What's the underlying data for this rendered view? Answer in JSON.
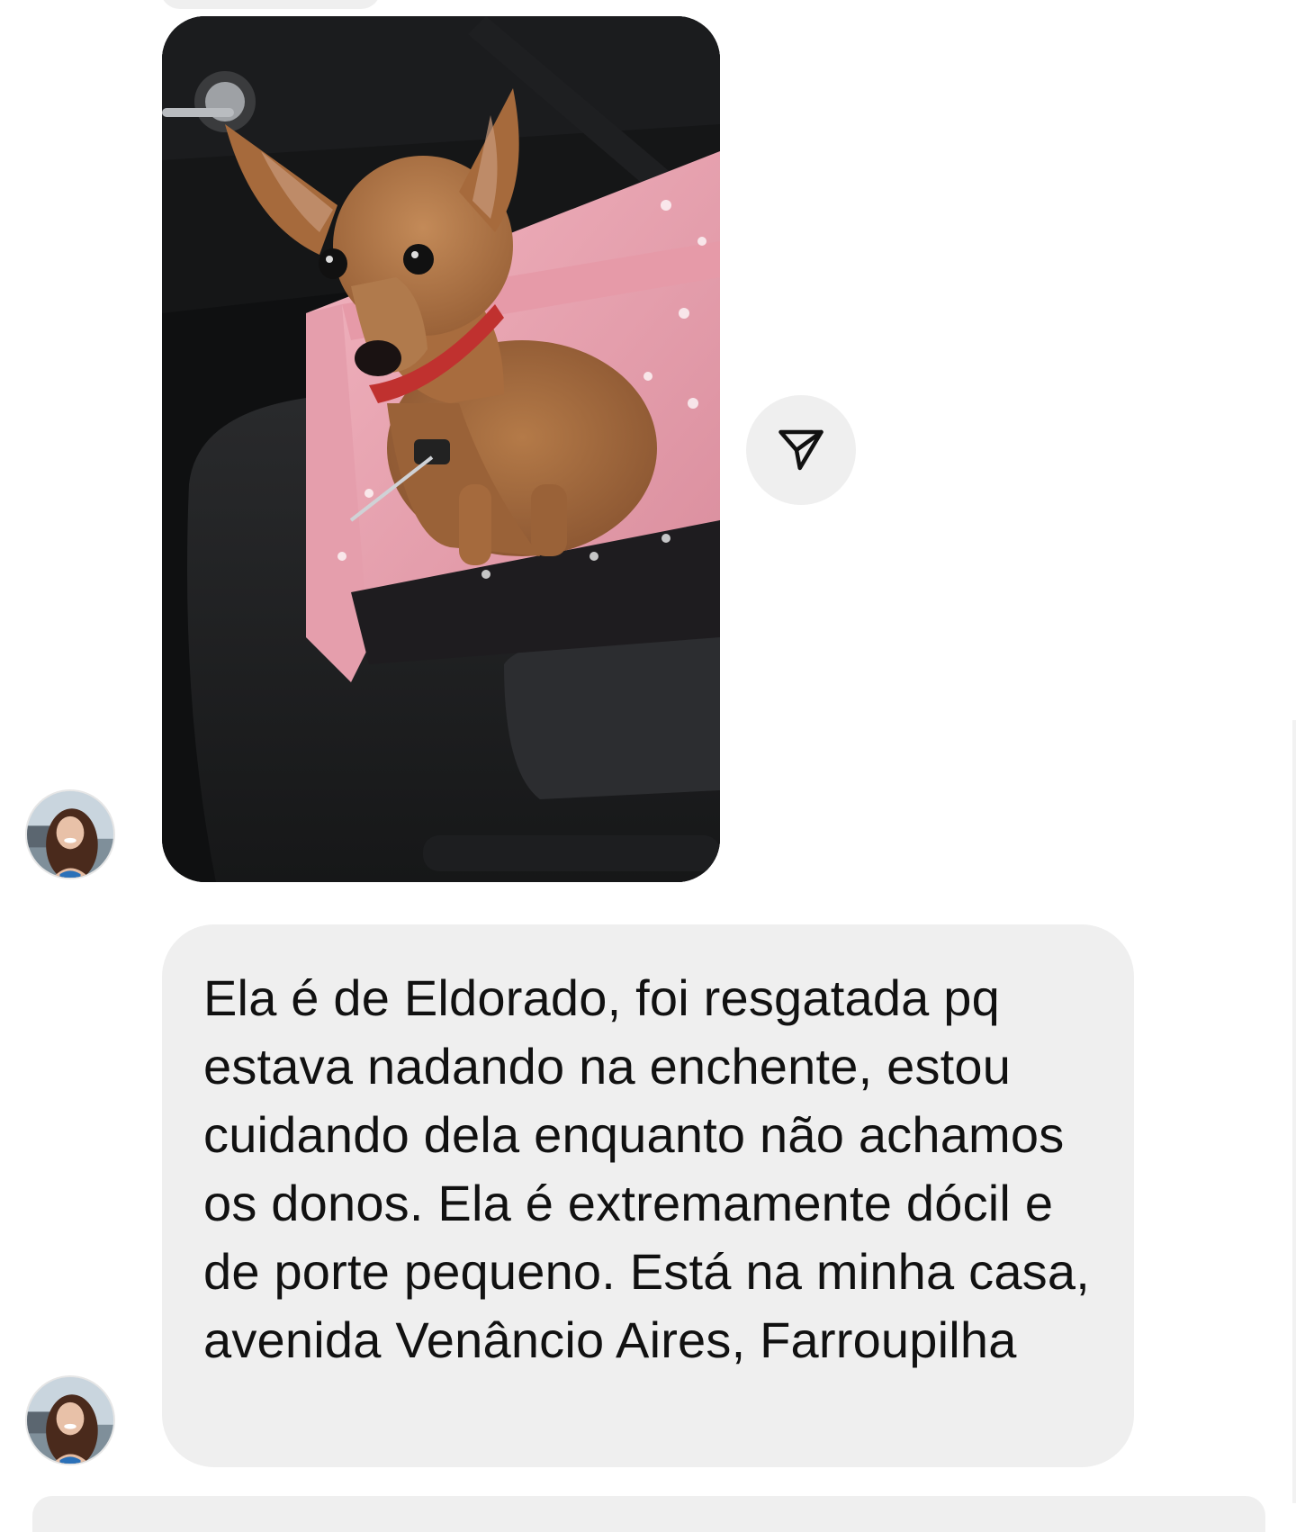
{
  "conversation": {
    "messages": [
      {
        "type": "image",
        "image_description_icon": "photo-dog-in-car-seat"
      },
      {
        "type": "text",
        "text": "Ela é de Eldorado, foi resgatada pq estava nadando na enchente, estou cuidando dela enquanto não achamos os donos. Ela é extremamente dócil e de porte pequeno. Está na minha casa, avenida Venâncio Aires, Farroupilha"
      }
    ],
    "share_icon": "paper-plane-icon"
  },
  "colors": {
    "bubble_bg": "#efefef",
    "text": "#111111",
    "page_bg": "#ffffff"
  }
}
